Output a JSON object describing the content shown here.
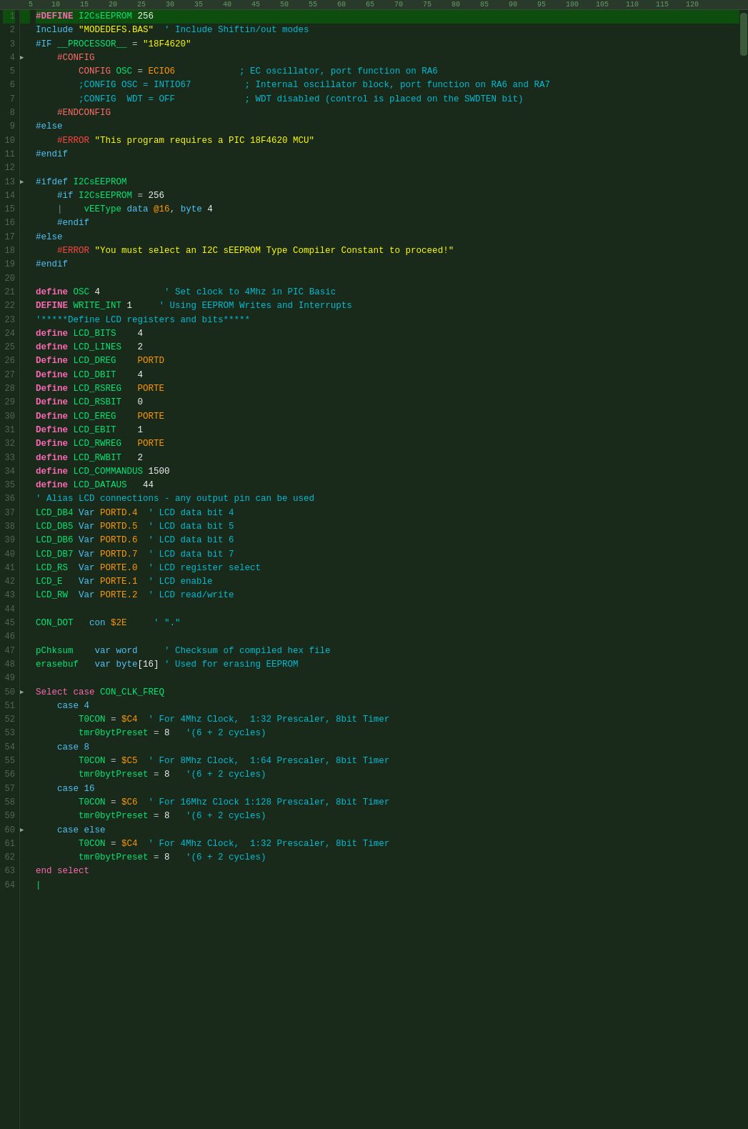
{
  "ruler": {
    "marks": [
      "5",
      "",
      "",
      "",
      "10",
      "",
      "",
      "",
      "15",
      "",
      "",
      "",
      "20",
      "",
      "",
      "",
      "25",
      "",
      "",
      "",
      "30",
      "",
      "",
      "",
      "35",
      "",
      "",
      "",
      "40",
      "",
      "",
      "",
      "45",
      "",
      "",
      "",
      "50",
      "",
      "",
      "",
      "55",
      "",
      "",
      "",
      "60",
      "",
      "",
      "",
      "65",
      "",
      "",
      "",
      "70",
      "",
      "",
      "",
      "75",
      "",
      "",
      "",
      "80",
      "",
      "",
      "",
      "85",
      "",
      "",
      "",
      "90",
      "",
      "",
      "",
      "95",
      "",
      "",
      "",
      "100",
      "",
      "",
      "",
      "105",
      "",
      "",
      "",
      "110",
      "",
      "",
      "",
      "115",
      "",
      "",
      "",
      "120"
    ]
  },
  "lines": [
    {
      "n": 1,
      "fold": false,
      "selected": true,
      "html": "<span class='kw-define'>#DEFINE</span> <span class='kw-variable'>I2CsEEPROM</span> <span class='kw-number'>256</span>"
    },
    {
      "n": 2,
      "fold": false,
      "selected": false,
      "html": "<span class='kw-blue'>Include</span> <span class='kw-string'>\"MODEDEFS.BAS\"</span>  <span class='kw-comment'>' Include Shiftin/out modes</span>"
    },
    {
      "n": 3,
      "fold": false,
      "selected": false,
      "html": "<span class='kw-blue'>#IF</span> <span class='kw-variable'>__PROCESSOR__</span> = <span class='kw-string'>\"18F4620\"</span>"
    },
    {
      "n": 4,
      "fold": true,
      "selected": false,
      "html": "    <span class='kw-config'>#CONFIG</span>"
    },
    {
      "n": 5,
      "fold": false,
      "selected": false,
      "html": "        <span class='kw-config'>CONFIG</span> <span class='kw-variable'>OSC</span> = <span class='kw-orange'>ECIO6</span>            <span class='kw-comment'>; EC oscillator, port function on RA6</span>"
    },
    {
      "n": 6,
      "fold": false,
      "selected": false,
      "html": "        <span class='kw-comment'>;CONFIG OSC = INTIO67          ; Internal oscillator block, port function on RA6 and RA7</span>"
    },
    {
      "n": 7,
      "fold": false,
      "selected": false,
      "html": "        <span class='kw-comment'>;CONFIG  WDT = OFF             ; WDT disabled (control is placed on the SWDTEN bit)</span>"
    },
    {
      "n": 8,
      "fold": false,
      "selected": false,
      "html": "    <span class='kw-config'>#ENDCONFIG</span>"
    },
    {
      "n": 9,
      "fold": false,
      "selected": false,
      "html": "<span class='kw-blue'>#else</span>"
    },
    {
      "n": 10,
      "fold": false,
      "selected": false,
      "html": "    <span class='kw-error'>#ERROR</span> <span class='kw-string'>\"This program requires a PIC 18F4620 MCU\"</span>"
    },
    {
      "n": 11,
      "fold": false,
      "selected": false,
      "html": "<span class='kw-blue'>#endif</span>"
    },
    {
      "n": 12,
      "fold": false,
      "selected": false,
      "html": ""
    },
    {
      "n": 13,
      "fold": true,
      "selected": false,
      "html": "<span class='kw-blue'>#ifdef</span> <span class='kw-variable'>I2CsEEPROM</span>"
    },
    {
      "n": 14,
      "fold": false,
      "selected": false,
      "html": "    <span class='kw-blue'>#if</span> <span class='kw-variable'>I2CsEEPROM</span> = <span class='kw-number'>256</span>"
    },
    {
      "n": 15,
      "fold": false,
      "selected": false,
      "html": "    <span style='color:#888'>|</span>    <span class='kw-variable'>vEEType</span> <span class='kw-blue'>data</span> <span class='kw-orange'>@16</span>, <span class='kw-blue'>byte</span> <span class='kw-number'>4</span>"
    },
    {
      "n": 16,
      "fold": false,
      "selected": false,
      "html": "    <span class='kw-blue'>#endif</span>"
    },
    {
      "n": 17,
      "fold": false,
      "selected": false,
      "html": "<span class='kw-blue'>#else</span>"
    },
    {
      "n": 18,
      "fold": false,
      "selected": false,
      "html": "    <span class='kw-error'>#ERROR</span> <span class='kw-string'>\"You must select an I2C sEEPROM Type Compiler Constant to proceed!\"</span>"
    },
    {
      "n": 19,
      "fold": false,
      "selected": false,
      "html": "<span class='kw-blue'>#endif</span>"
    },
    {
      "n": 20,
      "fold": false,
      "selected": false,
      "html": ""
    },
    {
      "n": 21,
      "fold": false,
      "selected": false,
      "html": "<span class='kw-define'>define</span> <span class='kw-variable'>OSC</span> <span class='kw-number'>4</span>            <span class='kw-comment'>' Set clock to 4Mhz in PIC Basic</span>"
    },
    {
      "n": 22,
      "fold": false,
      "selected": false,
      "html": "<span class='kw-define'>DEFINE</span> <span class='kw-variable'>WRITE_INT</span> <span class='kw-number'>1</span>     <span class='kw-comment'>' Using EEPROM Writes and Interrupts</span>"
    },
    {
      "n": 23,
      "fold": false,
      "selected": false,
      "html": "<span class='kw-comment'>'*****Define LCD registers and bits*****</span>"
    },
    {
      "n": 24,
      "fold": false,
      "selected": false,
      "html": "<span class='kw-define'>define</span> <span class='kw-variable'>LCD_BITS</span>    <span class='kw-number'>4</span>"
    },
    {
      "n": 25,
      "fold": false,
      "selected": false,
      "html": "<span class='kw-define'>define</span> <span class='kw-variable'>LCD_LINES</span>   <span class='kw-number'>2</span>"
    },
    {
      "n": 26,
      "fold": false,
      "selected": false,
      "html": "<span class='kw-define'>Define</span> <span class='kw-variable'>LCD_DREG</span>    <span class='kw-orange'>PORTD</span>"
    },
    {
      "n": 27,
      "fold": false,
      "selected": false,
      "html": "<span class='kw-define'>Define</span> <span class='kw-variable'>LCD_DBIT</span>    <span class='kw-number'>4</span>"
    },
    {
      "n": 28,
      "fold": false,
      "selected": false,
      "html": "<span class='kw-define'>Define</span> <span class='kw-variable'>LCD_RSREG</span>   <span class='kw-orange'>PORTE</span>"
    },
    {
      "n": 29,
      "fold": false,
      "selected": false,
      "html": "<span class='kw-define'>Define</span> <span class='kw-variable'>LCD_RSBIT</span>   <span class='kw-number'>0</span>"
    },
    {
      "n": 30,
      "fold": false,
      "selected": false,
      "html": "<span class='kw-define'>Define</span> <span class='kw-variable'>LCD_EREG</span>    <span class='kw-orange'>PORTE</span>"
    },
    {
      "n": 31,
      "fold": false,
      "selected": false,
      "html": "<span class='kw-define'>Define</span> <span class='kw-variable'>LCD_EBIT</span>    <span class='kw-number'>1</span>"
    },
    {
      "n": 32,
      "fold": false,
      "selected": false,
      "html": "<span class='kw-define'>Define</span> <span class='kw-variable'>LCD_RWREG</span>   <span class='kw-orange'>PORTE</span>"
    },
    {
      "n": 33,
      "fold": false,
      "selected": false,
      "html": "<span class='kw-define'>define</span> <span class='kw-variable'>LCD_RWBIT</span>   <span class='kw-number'>2</span>"
    },
    {
      "n": 34,
      "fold": false,
      "selected": false,
      "html": "<span class='kw-define'>define</span> <span class='kw-variable'>LCD_COMMANDUS</span> <span class='kw-number'>1500</span>"
    },
    {
      "n": 35,
      "fold": false,
      "selected": false,
      "html": "<span class='kw-define'>define</span> <span class='kw-variable'>LCD_DATAUS</span>   <span class='kw-number'>44</span>"
    },
    {
      "n": 36,
      "fold": false,
      "selected": false,
      "html": "<span class='kw-comment'>' Alias LCD connections - any output pin can be used</span>"
    },
    {
      "n": 37,
      "fold": false,
      "selected": false,
      "html": "<span class='kw-variable'>LCD_DB4</span> <span class='kw-blue'>Var</span> <span class='kw-orange'>PORTD.4</span>  <span class='kw-comment'>' LCD data bit 4</span>"
    },
    {
      "n": 38,
      "fold": false,
      "selected": false,
      "html": "<span class='kw-variable'>LCD_DB5</span> <span class='kw-blue'>Var</span> <span class='kw-orange'>PORTD.5</span>  <span class='kw-comment'>' LCD data bit 5</span>"
    },
    {
      "n": 39,
      "fold": false,
      "selected": false,
      "html": "<span class='kw-variable'>LCD_DB6</span> <span class='kw-blue'>Var</span> <span class='kw-orange'>PORTD.6</span>  <span class='kw-comment'>' LCD data bit 6</span>"
    },
    {
      "n": 40,
      "fold": false,
      "selected": false,
      "html": "<span class='kw-variable'>LCD_DB7</span> <span class='kw-blue'>Var</span> <span class='kw-orange'>PORTD.7</span>  <span class='kw-comment'>' LCD data bit 7</span>"
    },
    {
      "n": 41,
      "fold": false,
      "selected": false,
      "html": "<span class='kw-variable'>LCD_RS</span>  <span class='kw-blue'>Var</span> <span class='kw-orange'>PORTE.0</span>  <span class='kw-comment'>' LCD register select</span>"
    },
    {
      "n": 42,
      "fold": false,
      "selected": false,
      "html": "<span class='kw-variable'>LCD_E</span>   <span class='kw-blue'>Var</span> <span class='kw-orange'>PORTE.1</span>  <span class='kw-comment'>' LCD enable</span>"
    },
    {
      "n": 43,
      "fold": false,
      "selected": false,
      "html": "<span class='kw-variable'>LCD_RW</span>  <span class='kw-blue'>Var</span> <span class='kw-orange'>PORTE.2</span>  <span class='kw-comment'>' LCD read/write</span>"
    },
    {
      "n": 44,
      "fold": false,
      "selected": false,
      "html": ""
    },
    {
      "n": 45,
      "fold": false,
      "selected": false,
      "html": "<span class='kw-variable'>CON_DOT</span>   <span class='kw-blue'>con</span> <span class='kw-orange'>$2E</span>     <span class='kw-comment'>' \".\"</span>"
    },
    {
      "n": 46,
      "fold": false,
      "selected": false,
      "html": ""
    },
    {
      "n": 47,
      "fold": false,
      "selected": false,
      "html": "<span class='kw-variable'>pChksum</span>    <span class='kw-blue'>var word</span>     <span class='kw-comment'>' Checksum of compiled hex file</span>"
    },
    {
      "n": 48,
      "fold": false,
      "selected": false,
      "html": "<span class='kw-variable'>erasebuf</span>   <span class='kw-blue'>var byte</span><span class='kw-number'>[16]</span> <span class='kw-comment'>' Used for erasing EEPROM</span>"
    },
    {
      "n": 49,
      "fold": false,
      "selected": false,
      "html": ""
    },
    {
      "n": 50,
      "fold": true,
      "selected": false,
      "html": "<span class='kw-select'>Select case</span> <span class='kw-variable'>CON_CLK_FREQ</span>"
    },
    {
      "n": 51,
      "fold": false,
      "selected": false,
      "html": "    <span class='kw-case'>case 4</span>"
    },
    {
      "n": 52,
      "fold": false,
      "selected": false,
      "html": "        <span class='kw-variable'>T0CON</span> = <span class='kw-orange'>$C4</span>  <span class='kw-comment'>' For 4Mhz Clock,  1:32 Prescaler, 8bit Timer</span>"
    },
    {
      "n": 53,
      "fold": false,
      "selected": false,
      "html": "        <span class='kw-variable'>tmr0bytPreset</span> = <span class='kw-number'>8</span>   <span class='kw-comment'>'(6 + 2 cycles)</span>"
    },
    {
      "n": 54,
      "fold": false,
      "selected": false,
      "html": "    <span class='kw-case'>case 8</span>"
    },
    {
      "n": 55,
      "fold": false,
      "selected": false,
      "html": "        <span class='kw-variable'>T0CON</span> = <span class='kw-orange'>$C5</span>  <span class='kw-comment'>' For 8Mhz Clock,  1:64 Prescaler, 8bit Timer</span>"
    },
    {
      "n": 56,
      "fold": false,
      "selected": false,
      "html": "        <span class='kw-variable'>tmr0bytPreset</span> = <span class='kw-number'>8</span>   <span class='kw-comment'>'(6 + 2 cycles)</span>"
    },
    {
      "n": 57,
      "fold": false,
      "selected": false,
      "html": "    <span class='kw-case'>case 16</span>"
    },
    {
      "n": 58,
      "fold": false,
      "selected": false,
      "html": "        <span class='kw-variable'>T0CON</span> = <span class='kw-orange'>$C6</span>  <span class='kw-comment'>' For 16Mhz Clock 1:128 Prescaler, 8bit Timer</span>"
    },
    {
      "n": 59,
      "fold": false,
      "selected": false,
      "html": "        <span class='kw-variable'>tmr0bytPreset</span> = <span class='kw-number'>8</span>   <span class='kw-comment'>'(6 + 2 cycles)</span>"
    },
    {
      "n": 60,
      "fold": true,
      "selected": false,
      "html": "    <span class='kw-case'>case else</span>"
    },
    {
      "n": 61,
      "fold": false,
      "selected": false,
      "html": "        <span class='kw-variable'>T0CON</span> = <span class='kw-orange'>$C4</span>  <span class='kw-comment'>' For 4Mhz Clock,  1:32 Prescaler, 8bit Timer</span>"
    },
    {
      "n": 62,
      "fold": false,
      "selected": false,
      "html": "        <span class='kw-variable'>tmr0bytPreset</span> = <span class='kw-number'>8</span>   <span class='kw-comment'>'(6 + 2 cycles)</span>"
    },
    {
      "n": 63,
      "fold": false,
      "selected": false,
      "html": "<span class='kw-select'>end select</span>"
    },
    {
      "n": 64,
      "fold": false,
      "selected": false,
      "html": "<span style='color:#00e676'>|</span>"
    }
  ]
}
